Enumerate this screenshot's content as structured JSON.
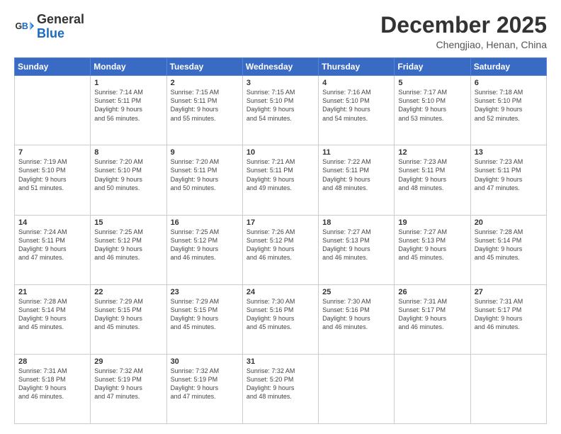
{
  "header": {
    "logo_general": "General",
    "logo_blue": "Blue",
    "month_title": "December 2025",
    "subtitle": "Chengjiao, Henan, China"
  },
  "days_of_week": [
    "Sunday",
    "Monday",
    "Tuesday",
    "Wednesday",
    "Thursday",
    "Friday",
    "Saturday"
  ],
  "weeks": [
    [
      {
        "day": "",
        "info": ""
      },
      {
        "day": "1",
        "info": "Sunrise: 7:14 AM\nSunset: 5:11 PM\nDaylight: 9 hours\nand 56 minutes."
      },
      {
        "day": "2",
        "info": "Sunrise: 7:15 AM\nSunset: 5:11 PM\nDaylight: 9 hours\nand 55 minutes."
      },
      {
        "day": "3",
        "info": "Sunrise: 7:15 AM\nSunset: 5:10 PM\nDaylight: 9 hours\nand 54 minutes."
      },
      {
        "day": "4",
        "info": "Sunrise: 7:16 AM\nSunset: 5:10 PM\nDaylight: 9 hours\nand 54 minutes."
      },
      {
        "day": "5",
        "info": "Sunrise: 7:17 AM\nSunset: 5:10 PM\nDaylight: 9 hours\nand 53 minutes."
      },
      {
        "day": "6",
        "info": "Sunrise: 7:18 AM\nSunset: 5:10 PM\nDaylight: 9 hours\nand 52 minutes."
      }
    ],
    [
      {
        "day": "7",
        "info": "Sunrise: 7:19 AM\nSunset: 5:10 PM\nDaylight: 9 hours\nand 51 minutes."
      },
      {
        "day": "8",
        "info": "Sunrise: 7:20 AM\nSunset: 5:10 PM\nDaylight: 9 hours\nand 50 minutes."
      },
      {
        "day": "9",
        "info": "Sunrise: 7:20 AM\nSunset: 5:11 PM\nDaylight: 9 hours\nand 50 minutes."
      },
      {
        "day": "10",
        "info": "Sunrise: 7:21 AM\nSunset: 5:11 PM\nDaylight: 9 hours\nand 49 minutes."
      },
      {
        "day": "11",
        "info": "Sunrise: 7:22 AM\nSunset: 5:11 PM\nDaylight: 9 hours\nand 48 minutes."
      },
      {
        "day": "12",
        "info": "Sunrise: 7:23 AM\nSunset: 5:11 PM\nDaylight: 9 hours\nand 48 minutes."
      },
      {
        "day": "13",
        "info": "Sunrise: 7:23 AM\nSunset: 5:11 PM\nDaylight: 9 hours\nand 47 minutes."
      }
    ],
    [
      {
        "day": "14",
        "info": "Sunrise: 7:24 AM\nSunset: 5:11 PM\nDaylight: 9 hours\nand 47 minutes."
      },
      {
        "day": "15",
        "info": "Sunrise: 7:25 AM\nSunset: 5:12 PM\nDaylight: 9 hours\nand 46 minutes."
      },
      {
        "day": "16",
        "info": "Sunrise: 7:25 AM\nSunset: 5:12 PM\nDaylight: 9 hours\nand 46 minutes."
      },
      {
        "day": "17",
        "info": "Sunrise: 7:26 AM\nSunset: 5:12 PM\nDaylight: 9 hours\nand 46 minutes."
      },
      {
        "day": "18",
        "info": "Sunrise: 7:27 AM\nSunset: 5:13 PM\nDaylight: 9 hours\nand 46 minutes."
      },
      {
        "day": "19",
        "info": "Sunrise: 7:27 AM\nSunset: 5:13 PM\nDaylight: 9 hours\nand 45 minutes."
      },
      {
        "day": "20",
        "info": "Sunrise: 7:28 AM\nSunset: 5:14 PM\nDaylight: 9 hours\nand 45 minutes."
      }
    ],
    [
      {
        "day": "21",
        "info": "Sunrise: 7:28 AM\nSunset: 5:14 PM\nDaylight: 9 hours\nand 45 minutes."
      },
      {
        "day": "22",
        "info": "Sunrise: 7:29 AM\nSunset: 5:15 PM\nDaylight: 9 hours\nand 45 minutes."
      },
      {
        "day": "23",
        "info": "Sunrise: 7:29 AM\nSunset: 5:15 PM\nDaylight: 9 hours\nand 45 minutes."
      },
      {
        "day": "24",
        "info": "Sunrise: 7:30 AM\nSunset: 5:16 PM\nDaylight: 9 hours\nand 45 minutes."
      },
      {
        "day": "25",
        "info": "Sunrise: 7:30 AM\nSunset: 5:16 PM\nDaylight: 9 hours\nand 46 minutes."
      },
      {
        "day": "26",
        "info": "Sunrise: 7:31 AM\nSunset: 5:17 PM\nDaylight: 9 hours\nand 46 minutes."
      },
      {
        "day": "27",
        "info": "Sunrise: 7:31 AM\nSunset: 5:17 PM\nDaylight: 9 hours\nand 46 minutes."
      }
    ],
    [
      {
        "day": "28",
        "info": "Sunrise: 7:31 AM\nSunset: 5:18 PM\nDaylight: 9 hours\nand 46 minutes."
      },
      {
        "day": "29",
        "info": "Sunrise: 7:32 AM\nSunset: 5:19 PM\nDaylight: 9 hours\nand 47 minutes."
      },
      {
        "day": "30",
        "info": "Sunrise: 7:32 AM\nSunset: 5:19 PM\nDaylight: 9 hours\nand 47 minutes."
      },
      {
        "day": "31",
        "info": "Sunrise: 7:32 AM\nSunset: 5:20 PM\nDaylight: 9 hours\nand 48 minutes."
      },
      {
        "day": "",
        "info": ""
      },
      {
        "day": "",
        "info": ""
      },
      {
        "day": "",
        "info": ""
      }
    ]
  ]
}
